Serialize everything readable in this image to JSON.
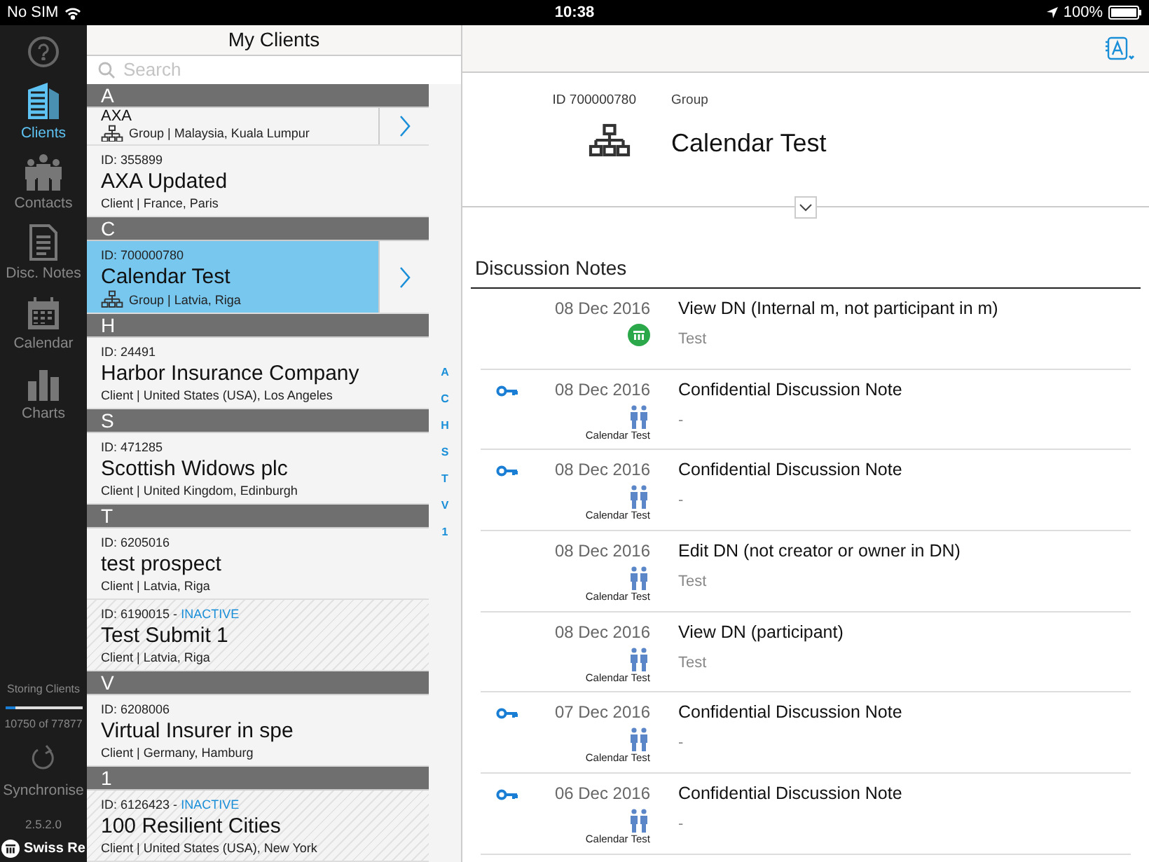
{
  "status_bar": {
    "carrier": "No SIM",
    "time": "10:38",
    "battery": "100%"
  },
  "sidebar": {
    "items": [
      {
        "label": "Clients",
        "kind": "building",
        "selected": true
      },
      {
        "label": "Contacts",
        "kind": "people",
        "selected": false
      },
      {
        "label": "Disc. Notes",
        "kind": "document",
        "selected": false
      },
      {
        "label": "Calendar",
        "kind": "calendar",
        "selected": false
      },
      {
        "label": "Charts",
        "kind": "chart",
        "selected": false
      }
    ],
    "progress": {
      "label": "Storing Clients",
      "level": 0.14,
      "reading": "10750 of 77877"
    },
    "sync_label": "Synchronise",
    "version": "2.5.2.0",
    "logo": "Swiss Re"
  },
  "client_list": {
    "title": "My Clients",
    "search": {
      "placeholder": "Search"
    },
    "rows": [
      {
        "kind": "section",
        "label": "A"
      },
      {
        "kind": "group",
        "partial": true,
        "name": "AXA",
        "details": "Group | Malaysia, Kuala Lumpur",
        "selected": false,
        "inactive": false,
        "action": true
      },
      {
        "kind": "client",
        "id": "ID: 355899",
        "name": "AXA Updated",
        "details": "Client | France, Paris",
        "selected": false,
        "inactive": false,
        "action": false
      },
      {
        "kind": "section",
        "label": "C"
      },
      {
        "kind": "group",
        "id": "ID: 700000780",
        "name": "Calendar Test",
        "details": "Group | Latvia, Riga",
        "selected": true,
        "inactive": false,
        "action": true
      },
      {
        "kind": "section",
        "label": "H"
      },
      {
        "kind": "client",
        "id": "ID: 24491",
        "name": "Harbor Insurance Company",
        "details": "Client | United States (USA), Los Angeles",
        "selected": false,
        "inactive": false,
        "action": false
      },
      {
        "kind": "section",
        "label": "S"
      },
      {
        "kind": "client",
        "id": "ID: 471285",
        "name": "Scottish Widows plc",
        "details": "Client | United Kingdom, Edinburgh",
        "selected": false,
        "inactive": false,
        "action": false
      },
      {
        "kind": "section",
        "label": "T"
      },
      {
        "kind": "client",
        "id": "ID: 6205016",
        "name": "test prospect",
        "details": "Client | Latvia, Riga",
        "selected": false,
        "inactive": false,
        "action": false
      },
      {
        "kind": "client",
        "id": "ID: 6190015 -",
        "status": "INACTIVE",
        "name": "Test Submit 1",
        "details": "Client | Latvia, Riga",
        "selected": false,
        "inactive": true,
        "action": false
      },
      {
        "kind": "section",
        "label": "V"
      },
      {
        "kind": "client",
        "id": "ID: 6208006",
        "name": "Virtual Insurer in spe",
        "details": "Client | Germany, Hamburg",
        "selected": false,
        "inactive": false,
        "action": false
      },
      {
        "kind": "section",
        "label": "1"
      },
      {
        "kind": "client",
        "id": "ID: 6126423 -",
        "status": "INACTIVE",
        "name": "100 Resilient Cities",
        "details": "Client | United States (USA), New York",
        "selected": false,
        "inactive": true,
        "action": false
      }
    ],
    "index": [
      "A",
      "C",
      "H",
      "S",
      "T",
      "V",
      "1"
    ]
  },
  "detail": {
    "id": "ID 700000780",
    "type": "Group",
    "name": "Calendar Test",
    "notes_title": "Discussion Notes",
    "notes": [
      {
        "confidential": false,
        "date": "08 Dec 2016",
        "kind": "meeting",
        "title": "View DN (Internal m, not participant in m)",
        "subtitle": "Test"
      },
      {
        "confidential": true,
        "date": "08 Dec 2016",
        "kind": "people",
        "owner": "Calendar Test",
        "title": "Confidential Discussion Note",
        "subtitle": "-"
      },
      {
        "confidential": true,
        "date": "08 Dec 2016",
        "kind": "people",
        "owner": "Calendar Test",
        "title": "Confidential Discussion Note",
        "subtitle": "-"
      },
      {
        "confidential": false,
        "date": "08 Dec 2016",
        "kind": "people",
        "owner": "Calendar Test",
        "title": "Edit DN (not creator or owner in DN)",
        "subtitle": "Test"
      },
      {
        "confidential": false,
        "date": "08 Dec 2016",
        "kind": "people",
        "owner": "Calendar Test",
        "title": "View DN (participant)",
        "subtitle": "Test"
      },
      {
        "confidential": true,
        "date": "07 Dec 2016",
        "kind": "people",
        "owner": "Calendar Test",
        "title": "Confidential Discussion Note",
        "subtitle": "-"
      },
      {
        "confidential": true,
        "date": "06 Dec 2016",
        "kind": "people",
        "owner": "Calendar Test",
        "title": "Confidential Discussion Note",
        "subtitle": "-"
      }
    ]
  }
}
